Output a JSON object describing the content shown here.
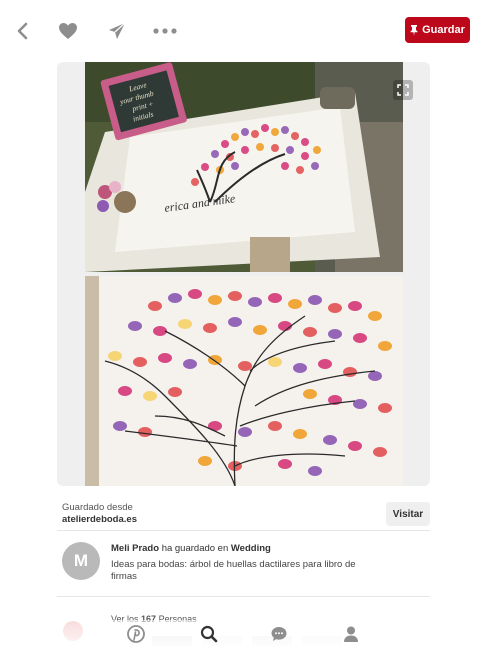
{
  "toolbar": {
    "back_icon": "chevron-left-icon",
    "like_icon": "heart-icon",
    "send_icon": "send-icon",
    "more_icon": "more-dots-icon",
    "save_label": "Guardar",
    "save_icon": "pin-icon"
  },
  "pin": {
    "photo1_text": [
      "Leave",
      "your thumb",
      "print +",
      "initials"
    ],
    "photo1_sign": "erica and mike",
    "saved_from_label": "Guardado desde",
    "saved_from_source": "atelierdeboda.es",
    "visit_label": "Visitar"
  },
  "pinner": {
    "avatar_initial": "M",
    "name": "Meli Prado",
    "action": "ha guardado en",
    "board": "Wedding",
    "description": "Ideas para bodas: árbol de huellas dactilares para libro de firmas"
  },
  "more": {
    "prefix": "Ver los",
    "count": "167",
    "suffix": "Personas"
  },
  "colors": {
    "brand_red": "#bd081c",
    "icon_gray": "#8e8e8e"
  },
  "bottom_nav": {
    "items": [
      "pinterest-icon",
      "search-icon",
      "chat-icon",
      "profile-icon"
    ],
    "active": "search-icon"
  }
}
